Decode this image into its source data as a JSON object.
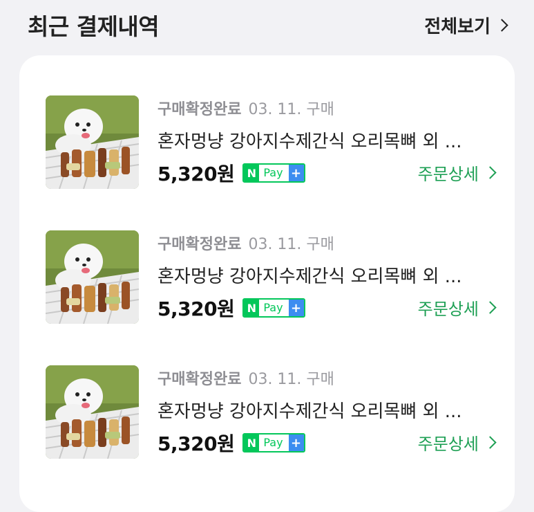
{
  "header": {
    "title": "최근 결제내역",
    "view_all": "전체보기"
  },
  "orders": [
    {
      "status": "구매확정완료",
      "date": "03. 11. 구매",
      "product": "혼자멍냥 강아지수제간식 오리목뼈 외 ...",
      "price": "5,320원",
      "pay_n": "N",
      "pay_label": "Pay",
      "pay_plus": "+",
      "detail_label": "주문상세"
    },
    {
      "status": "구매확정완료",
      "date": "03. 11. 구매",
      "product": "혼자멍냥 강아지수제간식 오리목뼈 외 ...",
      "price": "5,320원",
      "pay_n": "N",
      "pay_label": "Pay",
      "pay_plus": "+",
      "detail_label": "주문상세"
    },
    {
      "status": "구매확정완료",
      "date": "03. 11. 구매",
      "product": "혼자멍냥 강아지수제간식 오리목뼈 외 ...",
      "price": "5,320원",
      "pay_n": "N",
      "pay_label": "Pay",
      "pay_plus": "+",
      "detail_label": "주문상세"
    }
  ],
  "icons": {
    "view_all_chevron": "chevron-right-icon",
    "detail_chevron": "chevron-right-icon",
    "thumbnail": "dog-treats-photo"
  },
  "colors": {
    "background": "#f2f2f5",
    "card": "#ffffff",
    "npay_green": "#03c75a",
    "npay_blue": "#3c8df0",
    "detail_green": "#1fa055"
  }
}
